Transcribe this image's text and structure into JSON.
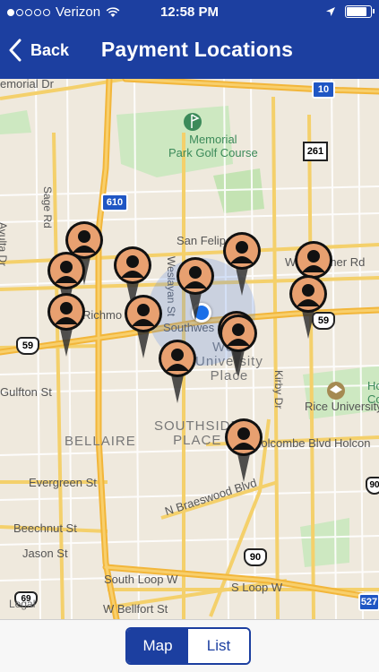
{
  "status_bar": {
    "carrier": "Verizon",
    "time": "12:58 PM",
    "signal_filled": 1,
    "signal_total": 5
  },
  "nav": {
    "back_label": "Back",
    "title": "Payment Locations"
  },
  "map": {
    "labels": {
      "memorial_dr": "emorial Dr",
      "memorial_park": "Memorial\nPark Golf Course",
      "sage_rd": "Sage Rd",
      "ayutla_dr": "Avulta Dr",
      "san_felipe": "San Felipe",
      "westheimer": "Westheimer Rd",
      "richmond": "Richmo",
      "southwest": "Southwes",
      "weslayan": "Weslayan St",
      "west_university": "West\nUniversity\nPlace",
      "kirby": "Kirby Dr",
      "gulfton": "Gulfton St",
      "rice": "Rice University",
      "bellaire": "BELLAIRE",
      "southside": "SOUTHSIDE\nPLACE",
      "holcombe": "Holcombe Blvd Holcon",
      "evergreen": "Evergreen St",
      "beechnut": "Beechnut St",
      "jason": "Jason St",
      "braeswood": "N Braeswood Blvd",
      "south_loop": "South Loop W",
      "s_loop": "S Loop W",
      "bellfort": "W Bellfort St",
      "ho": "Ho",
      "co": "Co"
    },
    "shields": {
      "i10": "10",
      "i610": "610",
      "us59_left": "59",
      "us59_right": "59",
      "sh261": "261",
      "sh90": "90",
      "sh527": "527",
      "i69_bottom": "69",
      "us90_right": "90"
    },
    "legal": "Legal",
    "pin_count": 12
  },
  "toolbar": {
    "map_label": "Map",
    "list_label": "List",
    "active": "Map"
  },
  "colors": {
    "brand": "#1c3fa0",
    "pin_head": "#e8a070",
    "pin_silhouette": "#111111"
  }
}
